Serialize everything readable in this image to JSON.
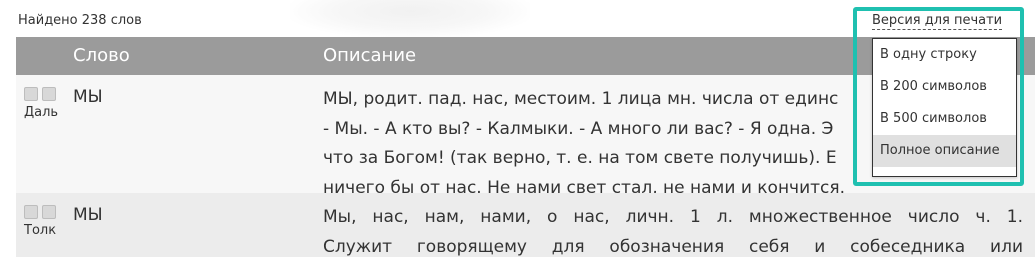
{
  "header": {
    "found_text": "Найдено 238 слов",
    "print_version_label": "Версия для печати"
  },
  "table": {
    "columns": [
      "Слово",
      "Описание"
    ],
    "rows": [
      {
        "source": "Даль",
        "word": "МЫ",
        "description_lines": [
          "МЫ, родит. пад. нас, местоим. 1 лица мн. числа от единс",
          "- Мы. - А кто вы? - Калмыки. - А много ли вас? - Я одна. Э",
          "что за Богом! (так верно, т. е. на том свете получишь). Е",
          "ничего бы от нас. Не нами свет стал, не нами и кончится."
        ]
      },
      {
        "source": "Толк",
        "word": "МЫ",
        "description_lines": [
          "Мы, нас, нам, нами, о нас, личн. 1 л. множественное число ч. 1.",
          "Служит говорящему для обозначения себя и собеседника или"
        ]
      }
    ]
  },
  "print_menu": {
    "items": [
      "В одну строку",
      "В 200 символов",
      "В 500 символов",
      "Полное описание"
    ],
    "selected": "Полное описание",
    "highlight_color": "#1fc0b0"
  }
}
